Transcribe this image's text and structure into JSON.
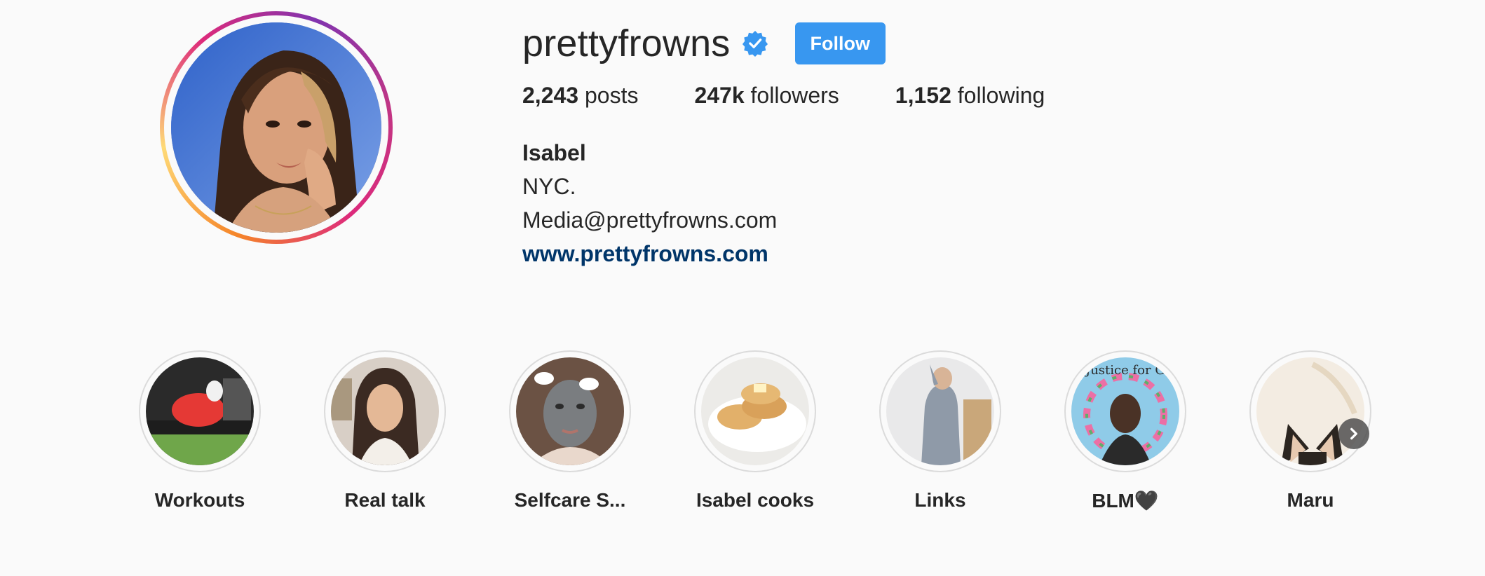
{
  "profile": {
    "username": "prettyfrowns",
    "verified_icon": "verified-badge-icon",
    "follow_label": "Follow",
    "stats": {
      "posts_count": "2,243",
      "posts_label": " posts",
      "followers_count": "247k",
      "followers_label": " followers",
      "following_count": "1,152",
      "following_label": " following"
    },
    "bio": {
      "name": "Isabel",
      "line1": "NYC.",
      "line2": "Media@prettyfrowns.com",
      "website": "www.prettyfrowns.com"
    }
  },
  "highlights": [
    {
      "label": "Workouts"
    },
    {
      "label": "Real talk"
    },
    {
      "label": "Selfcare S..."
    },
    {
      "label": "Isabel cooks"
    },
    {
      "label": "Links"
    },
    {
      "label": "BLM🖤"
    },
    {
      "label": "Maru"
    }
  ],
  "highlight_thumb_text": {
    "blm": "Justice for Geo"
  },
  "colors": {
    "follow_button": "#3897f0",
    "link": "#003569",
    "verified": "#3897f0",
    "text": "#262626",
    "background": "#fafafa"
  }
}
